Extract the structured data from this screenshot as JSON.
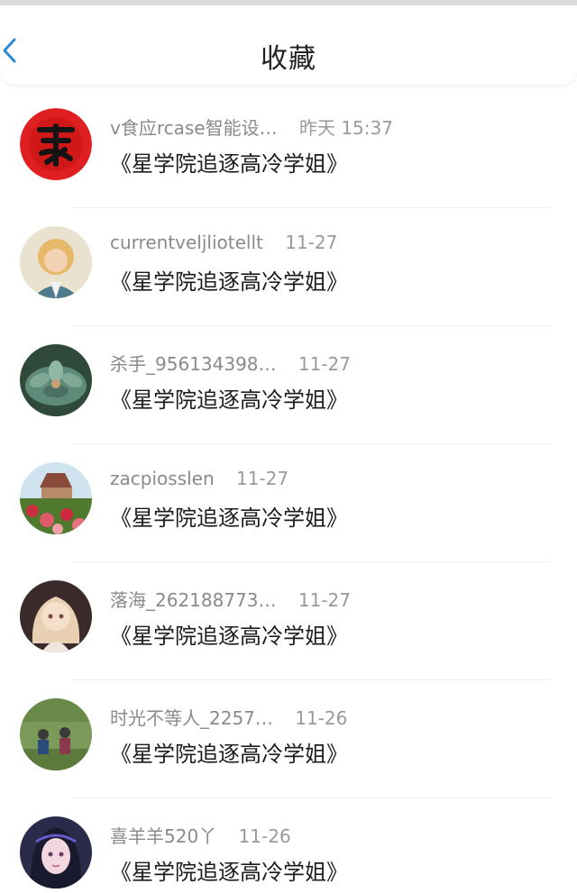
{
  "header": {
    "title": "收藏",
    "back_icon": "chevron-left-icon",
    "accent": "#2b8ad6"
  },
  "items": [
    {
      "username": "v食应rcase智能设…",
      "time": "昨天 15:37",
      "content": "《星学院追逐高冷学姐》"
    },
    {
      "username": "currentveljliotellt",
      "time": "11-27",
      "content": "《星学院追逐高冷学姐》"
    },
    {
      "username": "杀手_956134398…",
      "time": "11-27",
      "content": "《星学院追逐高冷学姐》"
    },
    {
      "username": "zacpiosslen",
      "time": "11-27",
      "content": "《星学院追逐高冷学姐》"
    },
    {
      "username": "落海_262188773…",
      "time": "11-27",
      "content": "《星学院追逐高冷学姐》"
    },
    {
      "username": "时光不等人_2257…",
      "time": "11-26",
      "content": "《星学院追逐高冷学姐》"
    },
    {
      "username": "喜羊羊520丫",
      "time": "11-26",
      "content": "《星学院追逐高冷学姐》"
    }
  ]
}
